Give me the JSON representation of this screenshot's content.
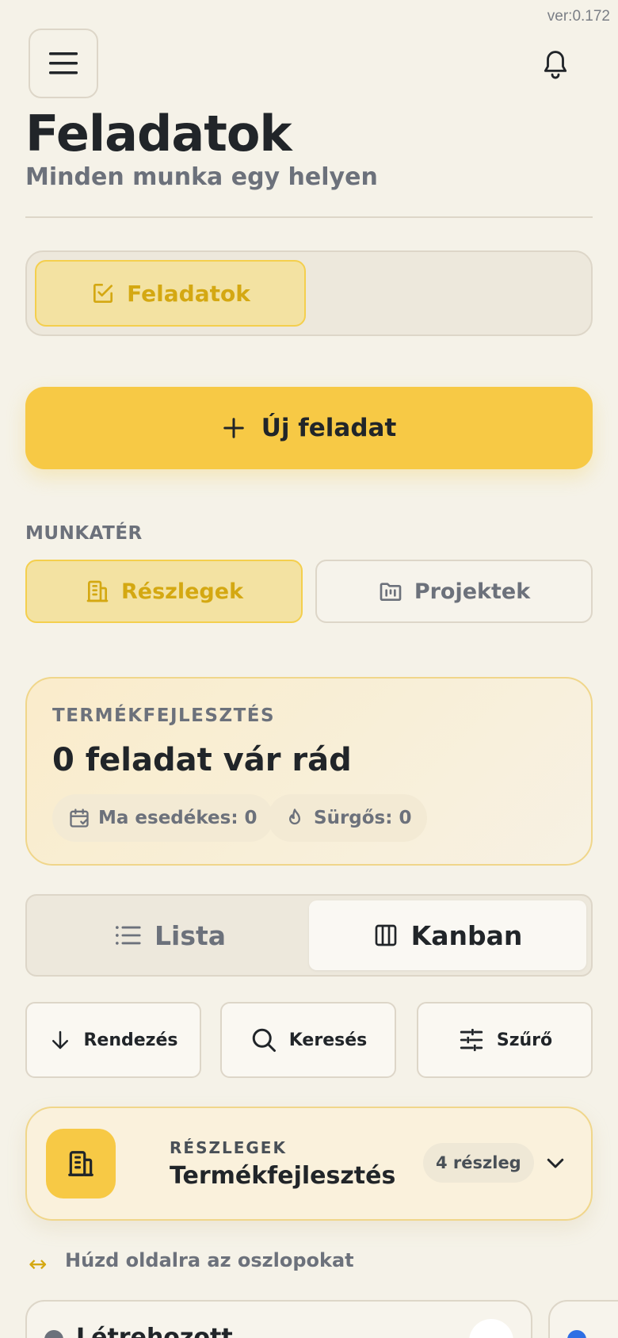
{
  "version": "ver:0.172",
  "header": {
    "title": "Feladatok",
    "subtitle": "Minden munka egy helyen"
  },
  "main_tab": {
    "label": "Feladatok"
  },
  "new_task": {
    "label": "Új feladat"
  },
  "workspace": {
    "section_label": "MUNKATÉR",
    "options": [
      {
        "label": "Részlegek",
        "active": true
      },
      {
        "label": "Projektek",
        "active": false
      }
    ]
  },
  "summary": {
    "eyebrow": "TERMÉKFEJLESZTÉS",
    "title": "0 feladat vár rád",
    "chips": [
      {
        "label": "Ma esedékes: 0",
        "icon": "calendar-check-icon"
      },
      {
        "label": "Sürgős: 0",
        "icon": "flame-icon"
      }
    ]
  },
  "view_toggle": {
    "options": [
      {
        "label": "Lista",
        "active": false
      },
      {
        "label": "Kanban",
        "active": true
      }
    ]
  },
  "toolbar": {
    "sort_label": "Rendezés",
    "search_label": "Keresés",
    "filter_label": "Szűrő"
  },
  "department": {
    "eyebrow": "RÉSZLEGEK",
    "name": "Termékfejlesztés",
    "count": "4 részleg"
  },
  "hint": {
    "icon": "↔",
    "text": "Húzd oldalra az oszlopokat"
  },
  "kanban": {
    "columns": [
      {
        "title": "Létrehozott"
      }
    ]
  },
  "colors": {
    "accent": "#f7c945",
    "accent_text": "#d4a812",
    "background": "#f5f2e8",
    "column2_dot": "#2f6fe4"
  }
}
